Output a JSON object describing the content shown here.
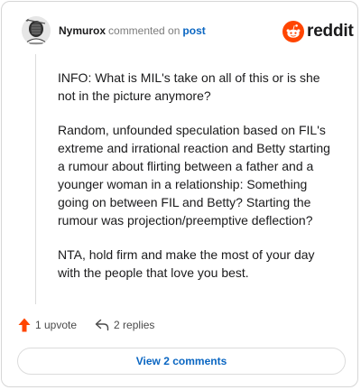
{
  "header": {
    "author": "Nymurox",
    "action": "commented on",
    "post_link": "post",
    "brand": "reddit",
    "avatar_icon": "fencer-avatar-icon",
    "brand_icon": "reddit-snoo-icon"
  },
  "comment": {
    "paragraphs": [
      "INFO: What is MIL's take on all of this or is she not in the picture anymore?",
      "Random, unfounded speculation based on FIL's extreme and irrational reaction and Betty starting a rumour about flirting between a father and a younger woman in a relationship: Something going on between FIL and Betty? Starting the rumour was projection/preemptive deflection?",
      "NTA, hold firm and make the most of your day with the people that love you best."
    ]
  },
  "actions": {
    "upvote_label": "1 upvote",
    "upvote_icon": "upvote-arrow-icon",
    "replies_label": "2 replies",
    "replies_icon": "reply-arrow-icon"
  },
  "view_comments_label": "View 2 comments",
  "colors": {
    "brand_orange": "#ff4500",
    "link_blue": "#0a66c2",
    "upvote_orange": "#ff4500",
    "border": "#d6d6d6"
  }
}
